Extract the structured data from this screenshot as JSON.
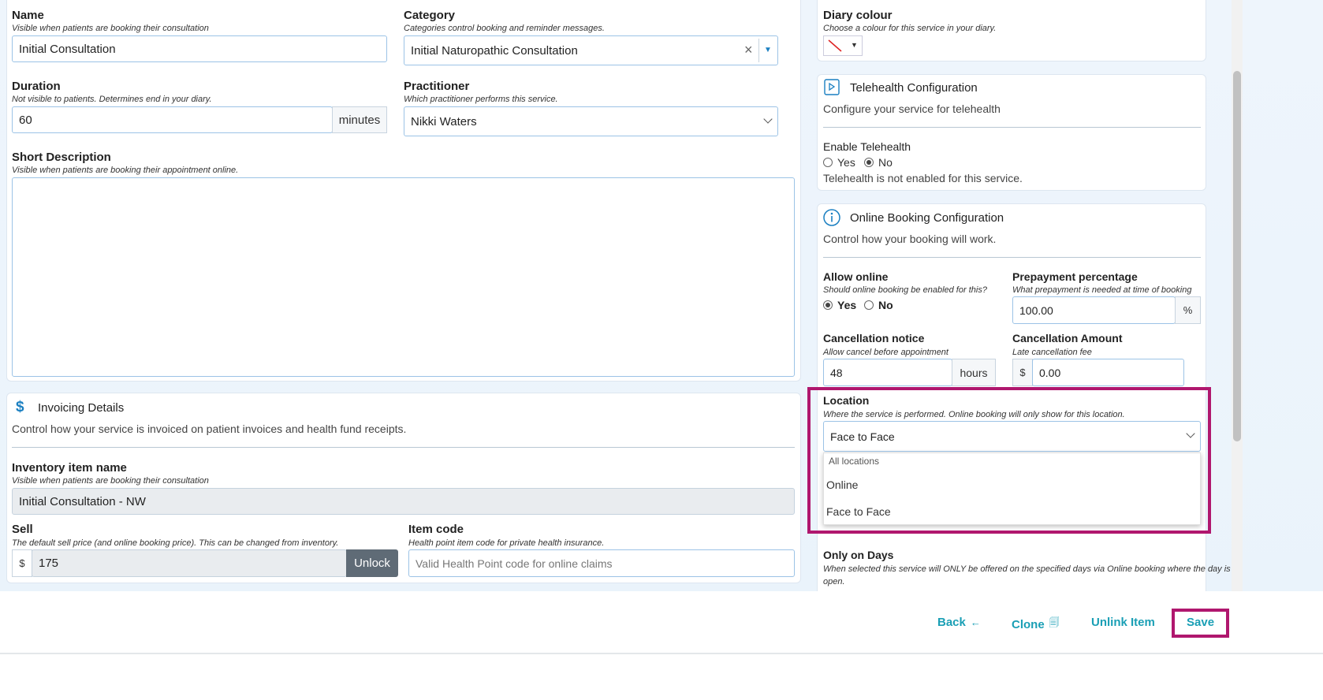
{
  "service": {
    "name_label": "Name",
    "name_hint": "Visible when patients are booking their consultation",
    "name_value": "Initial Consultation",
    "category_label": "Category",
    "category_hint": "Categories control booking and reminder messages.",
    "category_value": "Initial Naturopathic Consultation",
    "clear_symbol": "×",
    "dropdown_symbol": "▼",
    "duration_label": "Duration",
    "duration_hint": "Not visible to patients. Determines end in your diary.",
    "duration_value": "60",
    "duration_unit": "minutes",
    "practitioner_label": "Practitioner",
    "practitioner_hint": "Which practitioner performs this service.",
    "practitioner_value": "Nikki Waters",
    "short_desc_label": "Short Description",
    "short_desc_hint": "Visible when patients are booking their appointment online."
  },
  "invoicing": {
    "icon": "$",
    "title": "Invoicing Details",
    "subtitle": "Control how your service is invoiced on patient invoices and health fund receipts.",
    "inventory_label": "Inventory item name",
    "inventory_hint": "Visible when patients are booking their consultation",
    "inventory_value": "Initial Consultation - NW",
    "sell_label": "Sell",
    "sell_hint": "The default sell price (and online booking price). This can be changed from inventory.",
    "sell_currency": "$",
    "sell_value": "175",
    "unlock_label": "Unlock",
    "item_code_label": "Item code",
    "item_code_hint": "Health point item code for private health insurance.",
    "item_code_placeholder": "Valid Health Point code for online claims"
  },
  "diary": {
    "label": "Diary colour",
    "hint": "Choose a colour for this service in your diary."
  },
  "telehealth": {
    "title": "Telehealth Configuration",
    "subtitle": "Configure your service for telehealth",
    "enable_label": "Enable Telehealth",
    "yes": "Yes",
    "no": "No",
    "selected": "No",
    "status": "Telehealth is not enabled for this service."
  },
  "online_booking": {
    "title": "Online Booking Configuration",
    "subtitle": "Control how your booking will work.",
    "allow_label": "Allow online",
    "allow_hint": "Should online booking be enabled for this?",
    "allow_yes": "Yes",
    "allow_no": "No",
    "allow_selected": "Yes",
    "prepay_label": "Prepayment percentage",
    "prepay_hint": "What prepayment is needed at time of booking",
    "prepay_value": "100.00",
    "prepay_unit": "%",
    "cancel_notice_label": "Cancellation notice",
    "cancel_notice_hint": "Allow cancel before appointment",
    "cancel_notice_value": "48",
    "cancel_notice_unit": "hours",
    "cancel_amount_label": "Cancellation Amount",
    "cancel_amount_hint": "Late cancellation fee",
    "cancel_amount_currency": "$",
    "cancel_amount_value": "0.00",
    "location_label": "Location",
    "location_hint": "Where the service is performed. Online booking will only show for this location.",
    "location_value": "Face to Face",
    "location_options": [
      "All locations",
      "Online",
      "Face to Face"
    ],
    "days_label": "Only on Days",
    "days_hint_1": "When selected this service will ONLY be offered on the specified days via Online booking where the day is",
    "days_hint_2": "open."
  },
  "footer": {
    "back": "Back",
    "back_icon": "←",
    "clone": "Clone",
    "clone_icon": "🗐",
    "unlink": "Unlink Item",
    "save": "Save"
  },
  "colors": {
    "accent": "#1a9fb5",
    "highlight": "#b0176e",
    "input_border": "#9cc3e6"
  }
}
